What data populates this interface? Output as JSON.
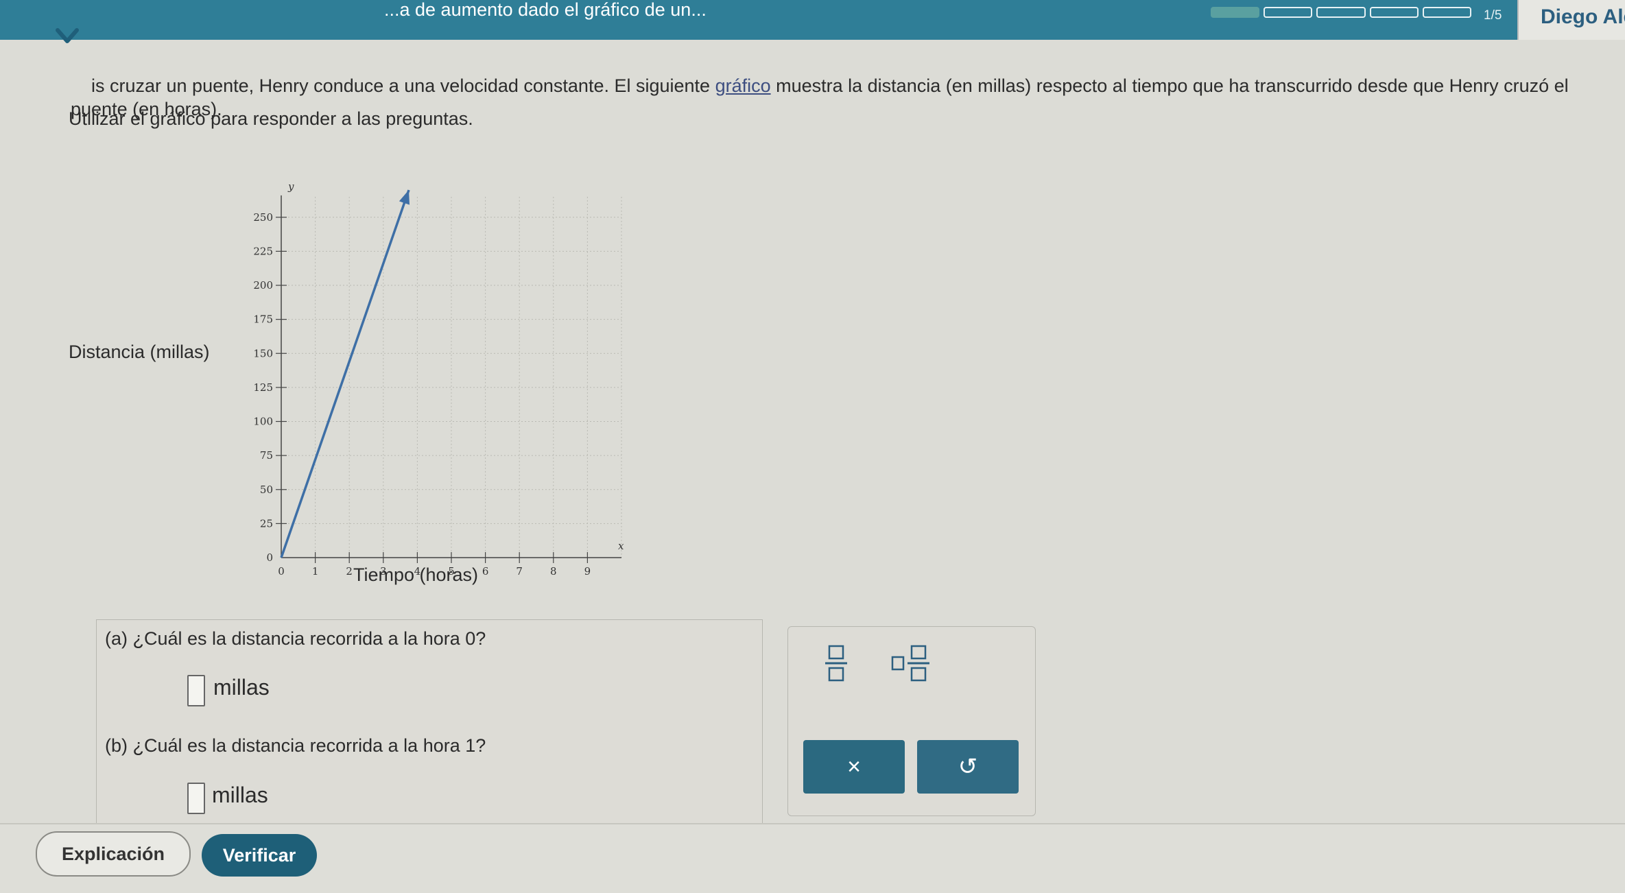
{
  "header": {
    "title": "...a de aumento dado el gráfico de un...",
    "progress": {
      "text": "1/5",
      "current": 1,
      "total": 5
    },
    "user_name": "Diego Ale"
  },
  "problem": {
    "text_before_link": "is cruzar un puente, Henry conduce a una velocidad constante. El siguiente ",
    "link": "gráfico",
    "text_after_link": " muestra la distancia (en millas) respecto al tiempo que ha transcurrido desde que Henry cruzó el puente (en horas).",
    "instruction": "Utilizar el gráfico para responder a las preguntas."
  },
  "chart_data": {
    "type": "line",
    "y_axis_label": "Distancia (millas)",
    "x_axis_label": "Tiempo (horas)",
    "x_axis_var": "x",
    "y_axis_var": "y",
    "x_ticks": [
      "0",
      "1",
      "2",
      "3",
      "4",
      "5",
      "6",
      "7",
      "8",
      "9"
    ],
    "y_ticks": [
      "0",
      "25",
      "50",
      "75",
      "100",
      "125",
      "150",
      "175",
      "200",
      "225",
      "250"
    ],
    "xlim": [
      0,
      10
    ],
    "ylim": [
      0,
      260
    ],
    "grid": true,
    "series": [
      {
        "x": [
          0,
          3.75
        ],
        "y": [
          0,
          270
        ]
      }
    ]
  },
  "questions": [
    {
      "label": "(a)  ¿Cuál es la distancia recorrida a la hora 0?",
      "unit": "millas",
      "value": ""
    },
    {
      "label": "(b)  ¿Cuál es la distancia recorrida a la hora 1?",
      "unit": "millas",
      "value": ""
    }
  ],
  "tools": {
    "clear_symbol": "×",
    "undo_symbol": "↺"
  },
  "footer": {
    "explain_label": "Explicación",
    "verify_label": "Verificar"
  }
}
